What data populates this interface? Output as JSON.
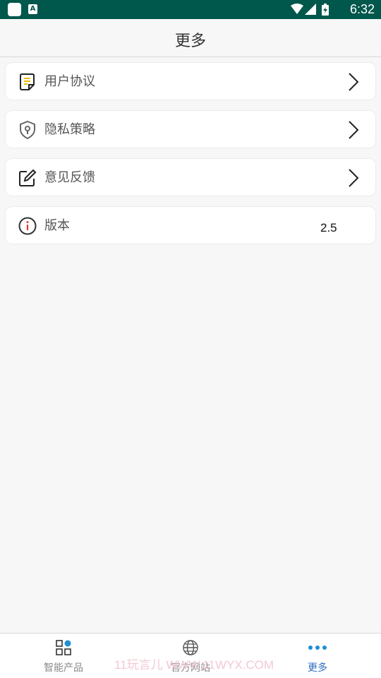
{
  "status_bar": {
    "time": "6:32",
    "notification_letter": "A"
  },
  "app_bar": {
    "title": "更多"
  },
  "menu": [
    {
      "label": "用户协议",
      "icon": "document-icon"
    },
    {
      "label": "隐私策略",
      "icon": "shield-lock-icon"
    },
    {
      "label": "意见反馈",
      "icon": "edit-icon"
    },
    {
      "label": "版本",
      "icon": "info-icon",
      "value": "2.5"
    }
  ],
  "tabs": [
    {
      "label": "智能产品",
      "icon": "grid-icon",
      "active": false
    },
    {
      "label": "官方网站",
      "icon": "globe-icon",
      "active": false
    },
    {
      "label": "更多",
      "icon": "more-dots-icon",
      "active": true
    }
  ],
  "watermark": "11玩言儿 WWW.11WYX.COM",
  "colors": {
    "status_bar": "#00574b",
    "accent": "#2d6cc0",
    "dot_blue": "#1e8fd6",
    "doc_yellow": "#f2b705",
    "info_red": "#e53935"
  }
}
